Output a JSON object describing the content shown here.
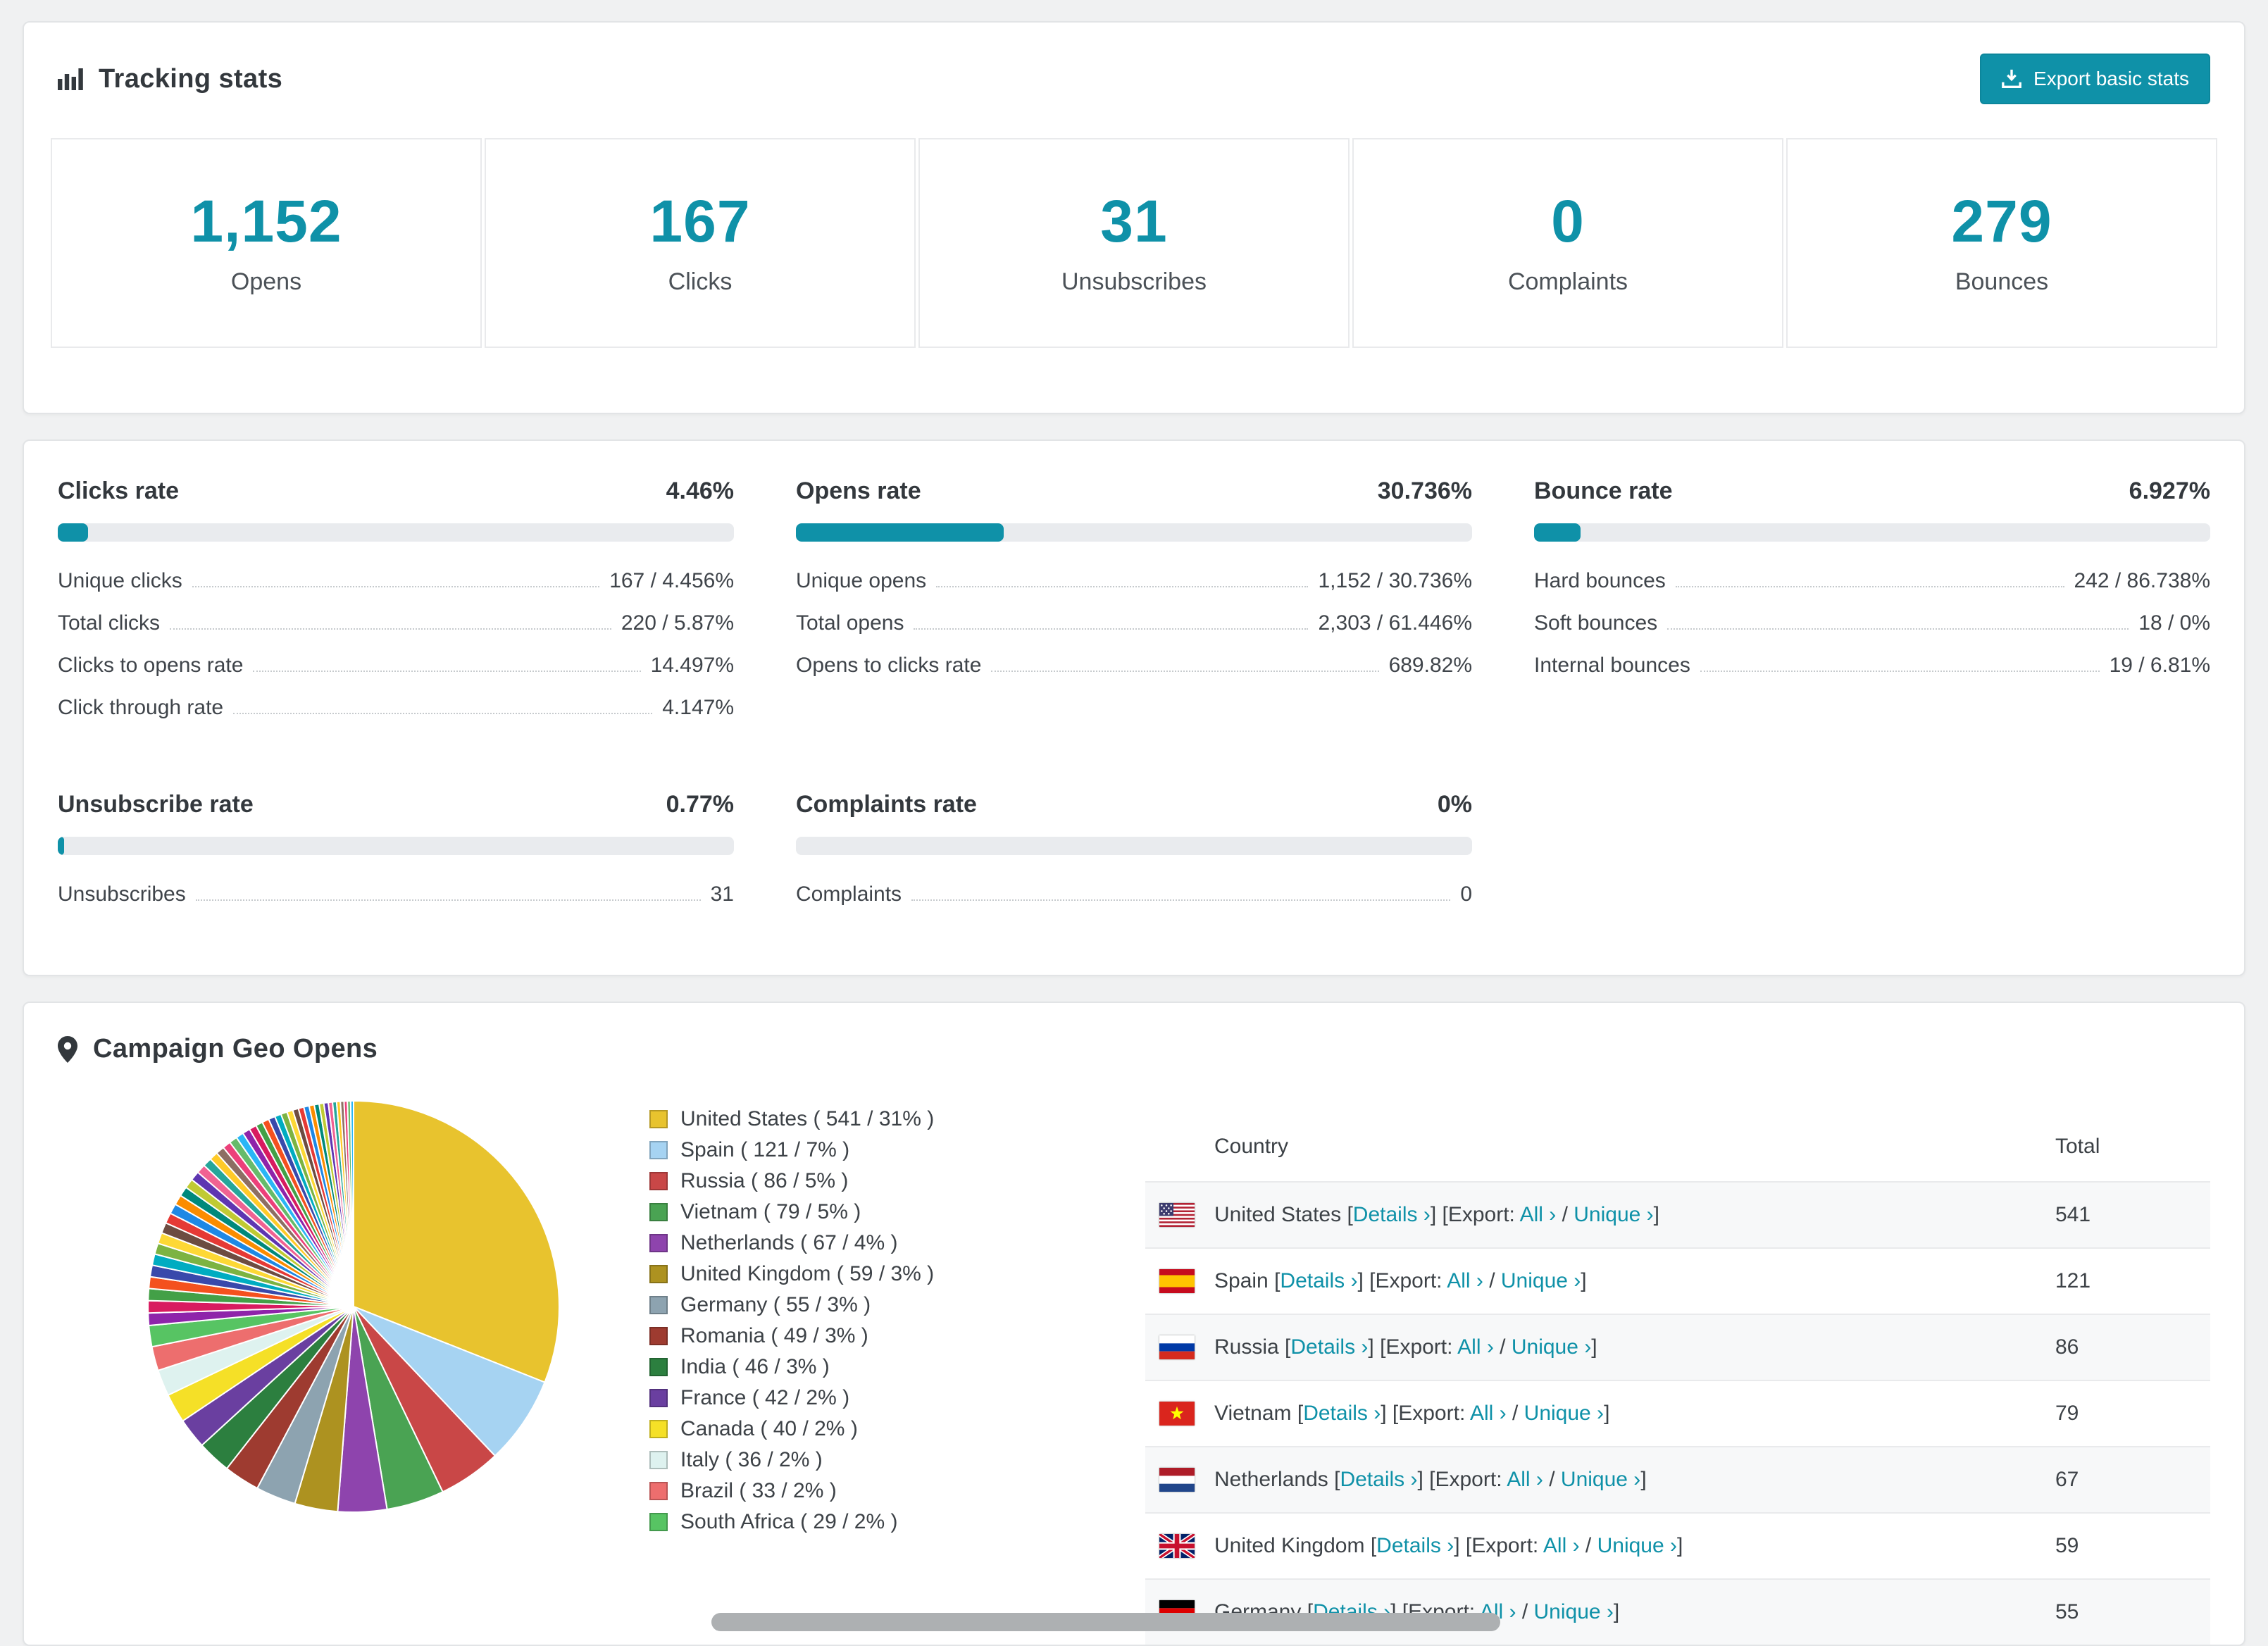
{
  "accent_color": "#0f91a8",
  "page_background": "#f0f1f2",
  "tracking": {
    "title": "Tracking stats",
    "title_icon": "bar-chart-icon",
    "export_button": {
      "label": "Export basic stats",
      "icon": "download-icon"
    },
    "stats": [
      {
        "value": "1,152",
        "label": "Opens"
      },
      {
        "value": "167",
        "label": "Clicks"
      },
      {
        "value": "31",
        "label": "Unsubscribes"
      },
      {
        "value": "0",
        "label": "Complaints"
      },
      {
        "value": "279",
        "label": "Bounces"
      }
    ]
  },
  "rates": [
    {
      "title": "Clicks rate",
      "value": "4.46%",
      "pct": 4.46,
      "rows": [
        {
          "label": "Unique clicks",
          "value": "167 / 4.456%"
        },
        {
          "label": "Total clicks",
          "value": "220 / 5.87%"
        },
        {
          "label": "Clicks to opens rate",
          "value": "14.497%"
        },
        {
          "label": "Click through rate",
          "value": "4.147%"
        }
      ]
    },
    {
      "title": "Opens rate",
      "value": "30.736%",
      "pct": 30.736,
      "rows": [
        {
          "label": "Unique opens",
          "value": "1,152 / 30.736%"
        },
        {
          "label": "Total opens",
          "value": "2,303 / 61.446%"
        },
        {
          "label": "Opens to clicks rate",
          "value": "689.82%"
        }
      ]
    },
    {
      "title": "Bounce rate",
      "value": "6.927%",
      "pct": 6.927,
      "rows": [
        {
          "label": "Hard bounces",
          "value": "242 / 86.738%"
        },
        {
          "label": "Soft bounces",
          "value": "18 / 0%"
        },
        {
          "label": "Internal bounces",
          "value": "19 / 6.81%"
        }
      ]
    },
    {
      "title": "Unsubscribe rate",
      "value": "0.77%",
      "pct": 0.77,
      "rows": [
        {
          "label": "Unsubscribes",
          "value": "31"
        }
      ]
    },
    {
      "title": "Complaints rate",
      "value": "0%",
      "pct": 0,
      "rows": [
        {
          "label": "Complaints",
          "value": "0"
        }
      ]
    }
  ],
  "geo": {
    "title": "Campaign Geo Opens",
    "title_icon": "map-pin-icon",
    "table": {
      "headers": [
        "Country",
        "Total"
      ],
      "links": {
        "details": "Details",
        "export_prefix": "Export:",
        "all": "All",
        "unique": "Unique",
        "arrow": "›"
      },
      "rows": [
        {
          "country": "United States",
          "flag": "us",
          "total": "541"
        },
        {
          "country": "Spain",
          "flag": "es",
          "total": "121"
        },
        {
          "country": "Russia",
          "flag": "ru",
          "total": "86"
        },
        {
          "country": "Vietnam",
          "flag": "vn",
          "total": "79"
        },
        {
          "country": "Netherlands",
          "flag": "nl",
          "total": "67"
        },
        {
          "country": "United Kingdom",
          "flag": "gb",
          "total": "59"
        },
        {
          "country": "Germany",
          "flag": "de",
          "total": "55"
        }
      ]
    }
  },
  "chart_data": {
    "type": "pie",
    "title": "Campaign Geo Opens",
    "legend_position": "right",
    "categories": [
      "United States",
      "Spain",
      "Russia",
      "Vietnam",
      "Netherlands",
      "United Kingdom",
      "Germany",
      "Romania",
      "India",
      "France",
      "Canada",
      "Italy",
      "Brazil",
      "South Africa"
    ],
    "values": [
      541,
      121,
      86,
      79,
      67,
      59,
      55,
      49,
      46,
      42,
      40,
      36,
      33,
      29
    ],
    "percents": [
      31,
      7,
      5,
      5,
      4,
      3,
      3,
      3,
      3,
      2,
      2,
      2,
      2,
      2
    ],
    "colors": [
      "#e8c32e",
      "#a6d3f2",
      "#c94747",
      "#4aa353",
      "#8e44ad",
      "#ad9220",
      "#8da3b0",
      "#9e3b30",
      "#2c7f3f",
      "#6a3fa0",
      "#f5e027",
      "#def2ef",
      "#ed6e6e",
      "#57c463"
    ],
    "unlabeled_small_slices": {
      "approx_total_value": 462,
      "approx_count": 44
    },
    "small_slice_palette": [
      "#8e24aa",
      "#d81b60",
      "#43a047",
      "#f4511e",
      "#3949ab",
      "#00acc1",
      "#7cb342",
      "#fdd835",
      "#6d4c41",
      "#e53935",
      "#1e88e5",
      "#fb8c00",
      "#00897b",
      "#c0ca33",
      "#5e35b1",
      "#f06292",
      "#26a69a",
      "#ffca28",
      "#8d6e63",
      "#ec407a",
      "#66bb6a",
      "#29b6f6"
    ]
  }
}
